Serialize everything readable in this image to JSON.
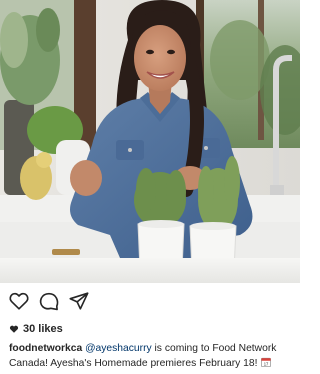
{
  "post": {
    "image_alt": "Woman in denim shirt smiling behind two potted herb plants in a kitchen",
    "actions": {
      "like_icon": "heart-outline-icon",
      "comment_icon": "speech-bubble-icon",
      "share_icon": "paper-plane-icon"
    },
    "likes": {
      "icon": "heart-filled-icon",
      "count_text": "30 likes"
    },
    "caption": {
      "username": "foodnetworkca",
      "mention": "@ayeshacurry",
      "text_line1": " is coming to Food Network",
      "text_line2": "Canada!  Ayesha's Homemade premieres February 18! ",
      "emoji": "calendar-emoji-icon"
    }
  },
  "colors": {
    "text": "#262626",
    "mention": "#003569",
    "background": "#ffffff"
  }
}
